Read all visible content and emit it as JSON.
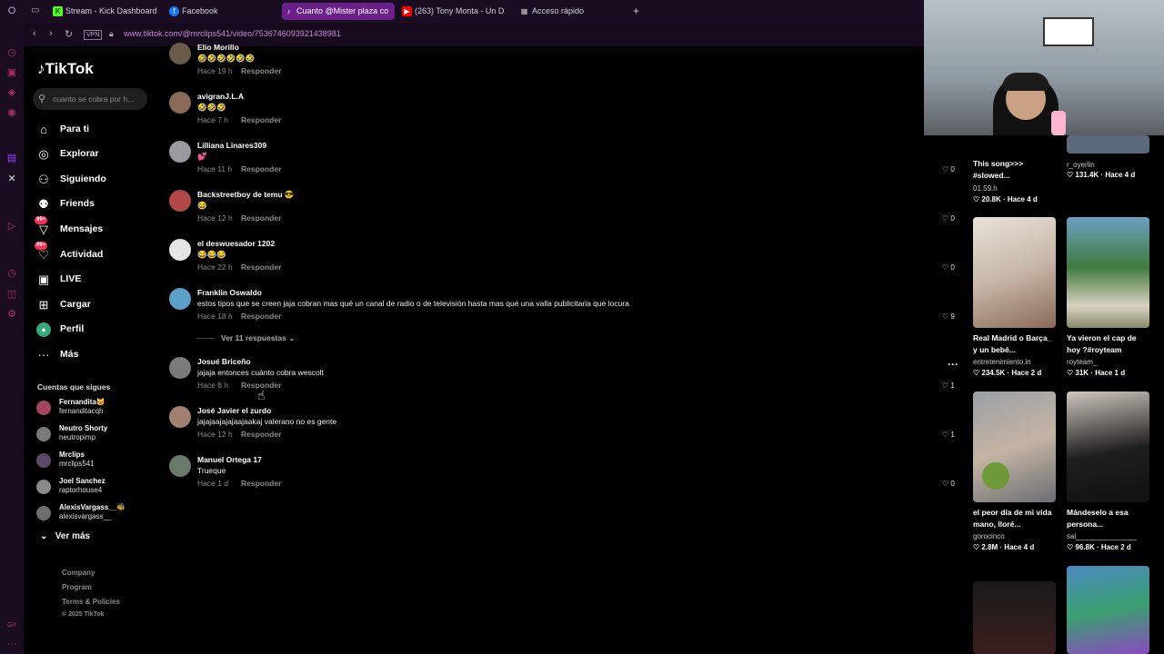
{
  "browser": {
    "tabs": [
      {
        "icon": "kick-icon",
        "label": "Stream - Kick Dashboard"
      },
      {
        "icon": "facebook-icon",
        "label": "Facebook"
      },
      {
        "icon": "tiktok-icon",
        "label": "Cuanto @Mister plaza co"
      },
      {
        "icon": "youtube-icon",
        "label": "(263) Tony Monta - Un D"
      },
      {
        "icon": "grid-icon",
        "label": "Acceso rápido"
      }
    ],
    "new_tab": "+",
    "vpn_label": "VPN",
    "url": "www.tiktok.com/@mrclips541/video/7536746093921438981"
  },
  "sidebar": {
    "logo": "TikTok",
    "search_placeholder": "cuanto se cobra por h...",
    "nav": [
      {
        "label": "Para ti",
        "icon": "home-icon"
      },
      {
        "label": "Explorar",
        "icon": "compass-icon"
      },
      {
        "label": "Siguiendo",
        "icon": "following-icon"
      },
      {
        "label": "Friends",
        "icon": "friends-icon"
      },
      {
        "label": "Mensajes",
        "icon": "messages-icon",
        "badge": "99+"
      },
      {
        "label": "Actividad",
        "icon": "activity-icon",
        "badge": "99+"
      },
      {
        "label": "LIVE",
        "icon": "live-icon"
      },
      {
        "label": "Cargar",
        "icon": "upload-icon"
      },
      {
        "label": "Perfil",
        "icon": "profile-icon"
      },
      {
        "label": "Más",
        "icon": "more-icon"
      }
    ],
    "following_title": "Cuentas que sigues",
    "following": [
      {
        "name": "Fernandita🐱",
        "user": "fernanditacqh"
      },
      {
        "name": "Neutro Shorty",
        "user": "neutropimp"
      },
      {
        "name": "Mrclips",
        "user": "mrclips541"
      },
      {
        "name": "Joel Sanchez",
        "user": "raptorhouse4"
      },
      {
        "name": "AlexisVargass__🐝",
        "user": "alexisvargass__"
      }
    ],
    "see_more": "Ver más",
    "footer": [
      "Company",
      "Program",
      "Terms & Policies",
      "© 2025 TikTok"
    ]
  },
  "comments": {
    "reply_label": "Responder",
    "view_replies": "Ver 11 respuestas",
    "items": [
      {
        "user": "Elio Morillo",
        "text": "🤣🤣🤣🤣🤣🤣",
        "time": "Hace 19 h"
      },
      {
        "user": "avigranJ.L.A",
        "text": "🤣🤣🤣",
        "time": "Hace 7 h"
      },
      {
        "user": "Lilliana Linares309",
        "text": "💕",
        "time": "Hace 11 h"
      },
      {
        "user": "Backstreetboy de temu 😎",
        "text": "😂",
        "time": "Hace 12 h"
      },
      {
        "user": "el deswuesador 1202",
        "text": "😂😂😂",
        "time": "Hace 22 h"
      },
      {
        "user": "Franklin Oswaldo",
        "text": "estos tipos que se creen jaja cobran mas qué un canal de radio o de televisión hasta mas qué una valla publicitaria que locura",
        "time": "Hace 18 h"
      },
      {
        "user": "Josué Briceño",
        "text": "jajaja entonces cuánto cobra wescolt",
        "time": "Hace 8 h"
      },
      {
        "user": "José Javier el zurdo",
        "text": "jajajaajajajaajaakaj valerano no es gente",
        "time": "Hace 12 h"
      },
      {
        "user": "Manuel Ortega 17",
        "text": "Trueque",
        "time": "Hace 1 d"
      }
    ]
  },
  "right_panel": {
    "likes": [
      "0",
      "0",
      "0",
      "9",
      "1",
      "1",
      "0"
    ],
    "videos": [
      {
        "caption": "This song>>> #slowed...",
        "account": "01.59.h",
        "stats": "20.8K · Hace 4 d"
      },
      {
        "caption": "",
        "account": "r_oyerlin",
        "stats": "131.4K · Hace 4 d"
      },
      {
        "caption": "Real Madrid o Barça_ y un bebé...",
        "account": "entretenimiento.in",
        "stats": "234.5K · Hace 2 d"
      },
      {
        "caption": "Ya vieron el cap de hoy ?#royteam",
        "account": "royteam_",
        "stats": "31K · Hace 1 d"
      },
      {
        "caption": "el peor día de mi vida mano, lloré...",
        "account": "gorocinco",
        "stats": "2.8M · Hace 4 d"
      },
      {
        "caption": "Mándeselo a esa persona...",
        "account": "sai_______________",
        "stats": "96.8K · Hace 2 d"
      }
    ]
  }
}
